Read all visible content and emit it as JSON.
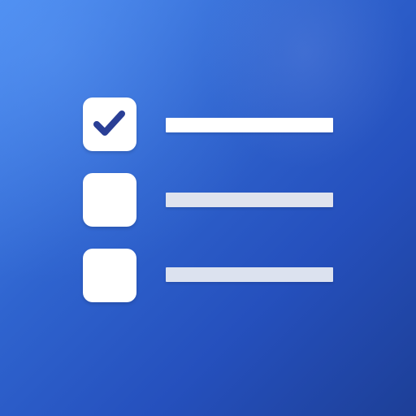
{
  "app_icon": {
    "name": "checklist",
    "colors": {
      "background_start": "#4a8bf0",
      "background_end": "#1d3f97",
      "checkbox_fill": "#ffffff",
      "checkmark": "#2a3f96",
      "line_primary": "#ffffff",
      "line_secondary": "#dfe3ee"
    },
    "items": [
      {
        "checked": true,
        "icon": "checkmark-icon"
      },
      {
        "checked": false,
        "icon": "empty-checkbox-icon"
      },
      {
        "checked": false,
        "icon": "empty-checkbox-icon"
      }
    ]
  }
}
